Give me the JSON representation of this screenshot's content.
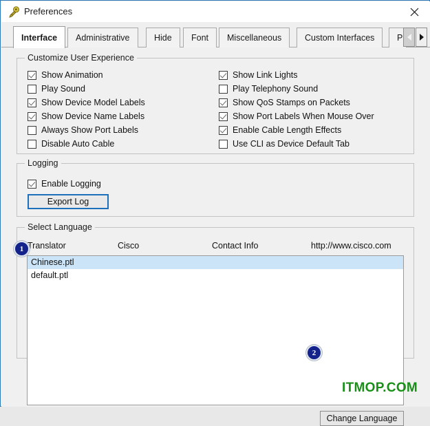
{
  "window": {
    "title": "Preferences",
    "icon": "preferences-key-icon",
    "close_label": "✕",
    "border_color": "#2e7ab8"
  },
  "tabs": [
    {
      "label": "Interface",
      "active": true
    },
    {
      "label": "Administrative",
      "active": false
    },
    {
      "label": "Hide",
      "active": false
    },
    {
      "label": "Font",
      "active": false
    },
    {
      "label": "Miscellaneous",
      "active": false
    },
    {
      "label": "Custom Interfaces",
      "active": false
    },
    {
      "label": "P",
      "active": false,
      "clipped": true
    }
  ],
  "tab_scroll": {
    "left_label": "◀",
    "right_label": "▶"
  },
  "customize_group": {
    "title": "Customize User Experience",
    "left_column": [
      {
        "label": "Show Animation",
        "checked": true
      },
      {
        "label": "Play Sound",
        "checked": false
      },
      {
        "label": "Show Device Model Labels",
        "checked": true
      },
      {
        "label": "Show Device Name Labels",
        "checked": true
      },
      {
        "label": "Always Show Port Labels",
        "checked": false
      },
      {
        "label": "Disable Auto Cable",
        "checked": false
      }
    ],
    "right_column": [
      {
        "label": "Show Link Lights",
        "checked": true
      },
      {
        "label": "Play Telephony Sound",
        "checked": false
      },
      {
        "label": "Show QoS Stamps on Packets",
        "checked": true
      },
      {
        "label": "Show Port Labels When Mouse Over",
        "checked": true
      },
      {
        "label": "Enable Cable Length Effects",
        "checked": true
      },
      {
        "label": "Use CLI as Device Default Tab",
        "checked": false
      }
    ]
  },
  "logging_group": {
    "title": "Logging",
    "enable_logging": {
      "label": "Enable Logging",
      "checked": true
    },
    "export_button": "Export Log",
    "export_button_focus_color": "#1c6fba"
  },
  "language_group": {
    "title": "Select Language",
    "headers": {
      "translator": "Translator",
      "vendor": "Cisco",
      "contact": "Contact Info",
      "url": "http://www.cisco.com"
    },
    "items": [
      {
        "name": "Chinese.ptl",
        "selected": true
      },
      {
        "name": "default.ptl",
        "selected": false
      }
    ],
    "selection_color": "#cce4f7",
    "change_button": "Change Language"
  },
  "callouts": [
    {
      "id": "1",
      "text": "1"
    },
    {
      "id": "2",
      "text": "2"
    }
  ],
  "watermark": {
    "text": "ITMOP.COM",
    "color": "#189018"
  }
}
